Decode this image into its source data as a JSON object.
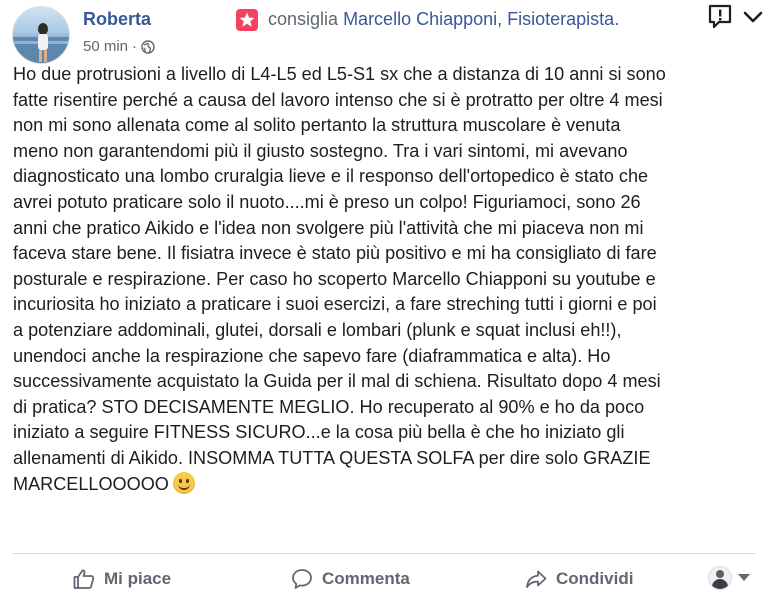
{
  "post": {
    "author": "Roberta",
    "verb": "consiglia",
    "page": "Marcello Chiapponi, Fisioterapista.",
    "time": "50 min",
    "separator": "·",
    "body_lines": [
      "Ho due protrusioni a livello di L4-L5 ed L5-S1 sx che a distanza di 10 anni si sono",
      "fatte risentire perché a causa del lavoro intenso che si è protratto per oltre 4 mesi",
      "non mi sono allenata come al solito pertanto la struttura muscolare è venuta",
      "meno non garantendomi più il giusto sostegno. Tra i vari sintomi, mi avevano",
      "diagnosticato una lombo cruralgia lieve e il responso dell'ortopedico è stato che",
      "avrei potuto praticare solo il nuoto....mi è preso un colpo! Figuriamoci, sono 26",
      "anni che pratico Aikido e l'idea non svolgere più l'attività che mi piaceva non mi",
      "faceva stare bene. Il fisiatra invece è stato più positivo e mi ha consigliato di fare",
      "posturale e respirazione. Per caso ho scoperto Marcello Chiapponi su youtube e",
      "incuriosita ho iniziato a praticare i suoi esercizi, a fare streching tutti i giorni e poi",
      "a potenziare addominali, glutei, dorsali e lombari (plunk e squat inclusi eh!!),",
      "unendoci anche la respirazione che sapevo fare (diaframmatica e alta). Ho",
      "successivamente acquistato la Guida per il mal di schiena. Risultato dopo 4 mesi",
      "di pratica? STO DECISAMENTE MEGLIO. Ho recuperato al 90% e ho da poco",
      "iniziato a seguire FITNESS SICURO...e la cosa più bella è che ho iniziato gli",
      "allenamenti di Aikido. INSOMMA TUTTA QUESTA SOLFA per dire solo GRAZIE",
      "MARCELLOOOOO"
    ]
  },
  "actions": {
    "like": "Mi piace",
    "comment": "Commenta",
    "share": "Condividi"
  },
  "icons": {
    "privacy": "globe-icon",
    "recommend": "recommendation-icon",
    "feedback": "feedback-icon",
    "more": "chevron-down-icon",
    "emoji": "smiley-emoji-icon"
  },
  "colors": {
    "link": "#385898",
    "muted": "#606770",
    "recommend": "#f3425f"
  }
}
